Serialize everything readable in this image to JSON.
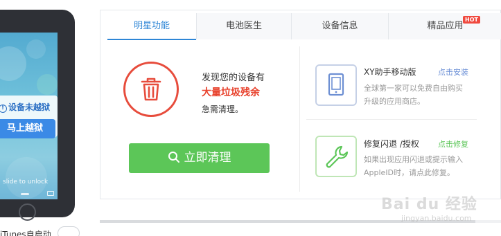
{
  "phone": {
    "jailbreak_status": "设备未越狱",
    "jailbreak_button": "马上越狱",
    "lock_hint": "slide to unlock"
  },
  "itunes": {
    "label": "iTunes自启动"
  },
  "tabs": [
    {
      "label": "明星功能",
      "active": true
    },
    {
      "label": "电池医生",
      "active": false
    },
    {
      "label": "设备信息",
      "active": false
    },
    {
      "label": "精品应用",
      "active": false,
      "badge": "HOT"
    }
  ],
  "cleanup": {
    "line1": "发现您的设备有",
    "line2": "大量垃圾残余",
    "line3": "急需清理。",
    "button": "立即清理"
  },
  "apps": [
    {
      "title": "XY助手移动版",
      "action": "点击安装",
      "action_color": "#6b8fd6",
      "desc_line1": "全球第一家可以免费自由购买",
      "desc_line2": "升级的应用商店。",
      "icon": "tablet-icon"
    },
    {
      "title": "修复闪退 /授权",
      "action": "点击修复",
      "action_color": "#5cc658",
      "desc_line1": "如果出现应用闪退或提示输入",
      "desc_line2": "AppleID时，请点此修复。",
      "icon": "wrench-icon"
    }
  ],
  "watermark": {
    "main": "Bai du 经验",
    "sub": "jingyan.baidu.com"
  }
}
